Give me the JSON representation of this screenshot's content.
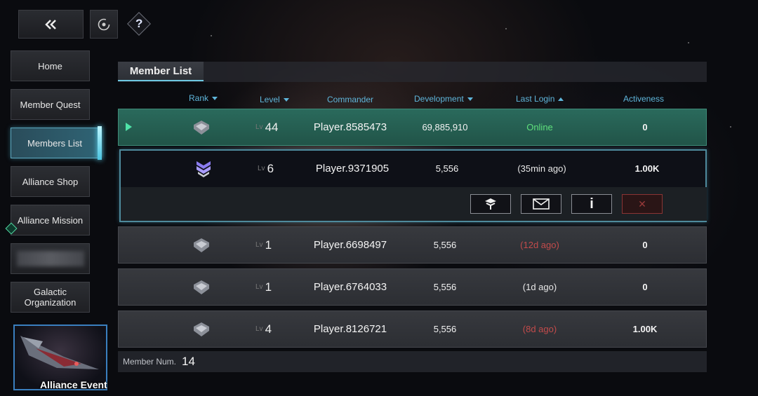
{
  "nav": {
    "back_icon": "double-chevron-left-icon",
    "refresh_icon": "refresh-icon",
    "help_label": "?"
  },
  "sidebar": {
    "items": [
      {
        "label": "Home",
        "active": false
      },
      {
        "label": "Member Quest",
        "active": false
      },
      {
        "label": "Members List",
        "active": true
      },
      {
        "label": "Alliance Shop",
        "active": false
      },
      {
        "label": "Alliance Mission",
        "active": false
      },
      {
        "label": "",
        "active": false,
        "blurred": true
      },
      {
        "label": "Galactic Organization",
        "active": false
      }
    ]
  },
  "event": {
    "label": "Alliance Event"
  },
  "panel": {
    "tab": "Member List",
    "columns": {
      "rank": "Rank",
      "level": "Level",
      "commander": "Commander",
      "development": "Development",
      "last_login": "Last Login",
      "activeness": "Activeness"
    },
    "members": [
      {
        "level_prefix": "Lv",
        "level": "44",
        "commander": "Player.8585473",
        "development": "69,885,910",
        "last_login": "Online",
        "activeness": "0",
        "status": "online",
        "self": true
      },
      {
        "level_prefix": "Lv",
        "level": "6",
        "commander": "Player.9371905",
        "development": "5,556",
        "last_login": "(35min ago)",
        "activeness": "1.00K",
        "status": "normal",
        "selected": true
      },
      {
        "level_prefix": "Lv",
        "level": "1",
        "commander": "Player.6698497",
        "development": "5,556",
        "last_login": "(12d ago)",
        "activeness": "0",
        "status": "inactive"
      },
      {
        "level_prefix": "Lv",
        "level": "1",
        "commander": "Player.6764033",
        "development": "5,556",
        "last_login": "(1d ago)",
        "activeness": "0",
        "status": "normal"
      },
      {
        "level_prefix": "Lv",
        "level": "4",
        "commander": "Player.8126721",
        "development": "5,556",
        "last_login": "(8d ago)",
        "activeness": "1.00K",
        "status": "inactive"
      }
    ],
    "actions": {
      "promote_icon": "rank-up-icon",
      "mail_icon": "envelope-icon",
      "info_label": "i",
      "kick_label": "✕"
    },
    "footer": {
      "label": "Member Num.",
      "value": "14"
    }
  },
  "colors": {
    "accent": "#5fb6db",
    "online": "#5fe07c",
    "inactive": "#c24b4b",
    "self_row": "#2a6a5c"
  }
}
